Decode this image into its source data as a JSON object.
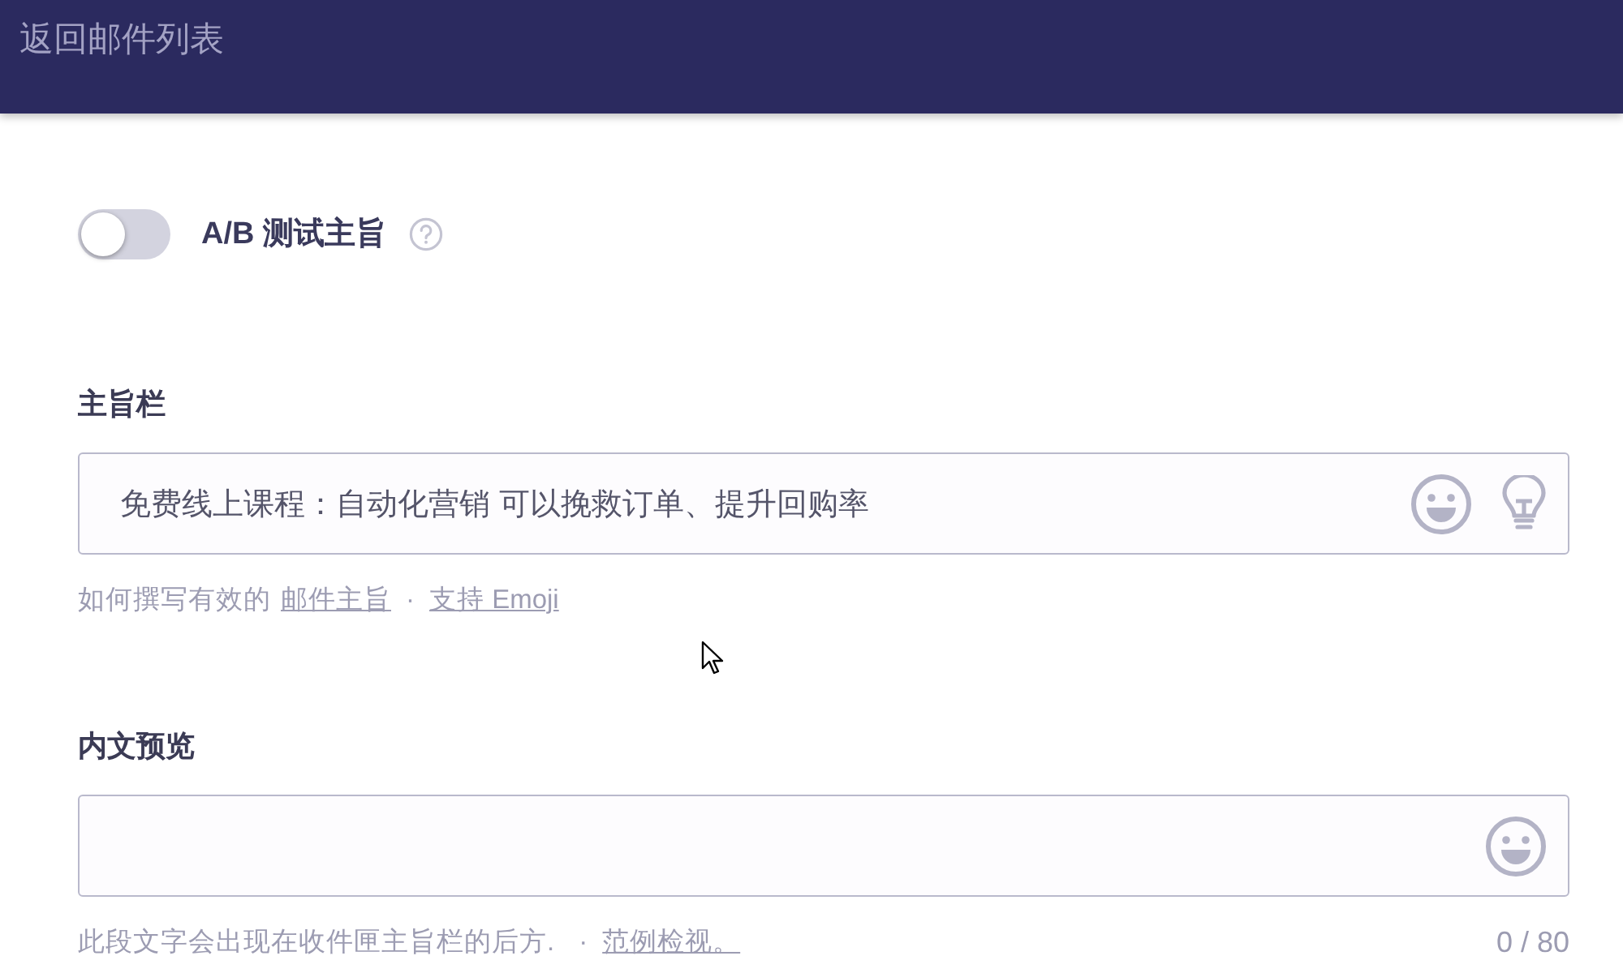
{
  "header": {
    "back_link": "返回邮件列表"
  },
  "ab_test": {
    "label": "A/B 测试主旨",
    "on": false
  },
  "subject": {
    "label": "主旨栏",
    "value": "免费线上课程：自动化营销 可以挽救订单、提升回购率",
    "hint": [
      {
        "kind": "text",
        "text": "如何撰写有效的"
      },
      {
        "kind": "link",
        "text": "邮件主旨"
      },
      {
        "kind": "separator",
        "text": "·"
      },
      {
        "kind": "link",
        "text": "支持 Emoji"
      }
    ]
  },
  "preview": {
    "label": "内文预览",
    "hint": [
      {
        "kind": "text",
        "text": "此段文字会出现在收件匣主旨栏的后方."
      },
      {
        "kind": "separator",
        "text": "·"
      },
      {
        "kind": "link",
        "text": "范例检视。"
      }
    ],
    "counter": "0 / 80"
  }
}
